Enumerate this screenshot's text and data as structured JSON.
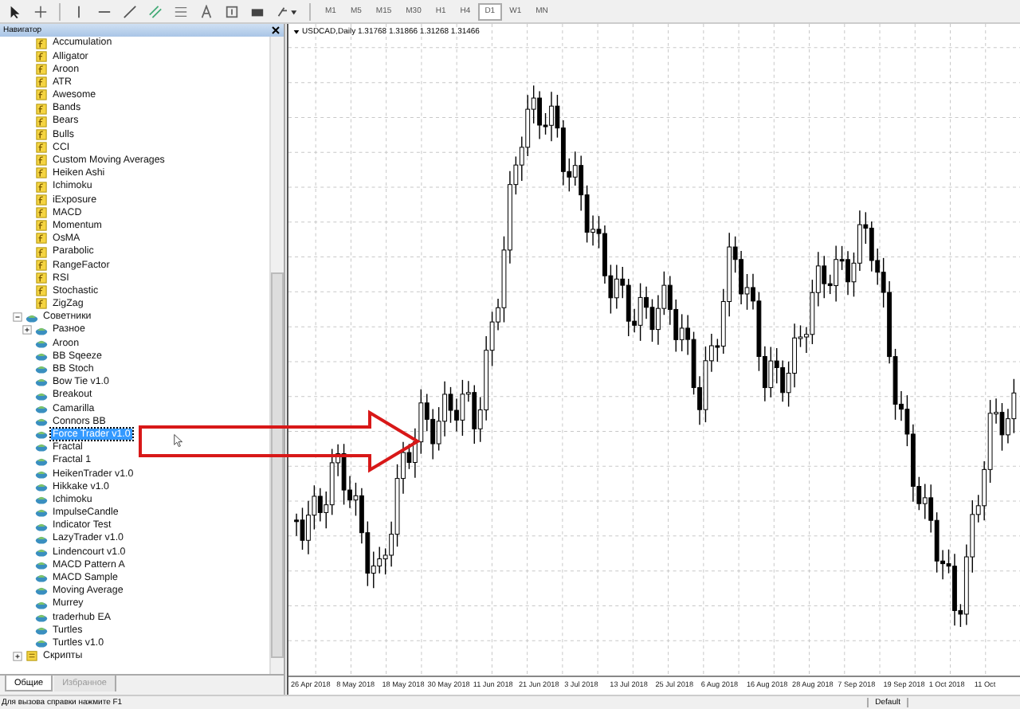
{
  "toolbar": {
    "timeframes": [
      {
        "label": "M1",
        "selected": false
      },
      {
        "label": "M5",
        "selected": false
      },
      {
        "label": "M15",
        "selected": false
      },
      {
        "label": "M30",
        "selected": false
      },
      {
        "label": "H1",
        "selected": false
      },
      {
        "label": "H4",
        "selected": false
      },
      {
        "label": "D1",
        "selected": true
      },
      {
        "label": "W1",
        "selected": false
      },
      {
        "label": "MN",
        "selected": false
      }
    ]
  },
  "navigator": {
    "title": "Навигатор",
    "indicators": [
      {
        "label": "Accumulation",
        "selected": false
      },
      {
        "label": "Alligator",
        "selected": false
      },
      {
        "label": "Aroon",
        "selected": false
      },
      {
        "label": "ATR",
        "selected": false
      },
      {
        "label": "Awesome",
        "selected": false
      },
      {
        "label": "Bands",
        "selected": false
      },
      {
        "label": "Bears",
        "selected": false
      },
      {
        "label": "Bulls",
        "selected": false
      },
      {
        "label": "CCI",
        "selected": false
      },
      {
        "label": "Custom Moving Averages",
        "selected": false
      },
      {
        "label": "Heiken Ashi",
        "selected": false
      },
      {
        "label": "Ichimoku",
        "selected": false
      },
      {
        "label": "iExposure",
        "selected": false
      },
      {
        "label": "MACD",
        "selected": false
      },
      {
        "label": "Momentum",
        "selected": false
      },
      {
        "label": "OsMA",
        "selected": false
      },
      {
        "label": "Parabolic",
        "selected": false
      },
      {
        "label": "RangeFactor",
        "selected": false
      },
      {
        "label": "RSI",
        "selected": false
      },
      {
        "label": "Stochastic",
        "selected": false
      },
      {
        "label": "ZigZag",
        "selected": false
      }
    ],
    "groups": [
      {
        "label": "Советники",
        "kind": "experts",
        "expanded": true,
        "children": [
          {
            "label": "Разное",
            "kind": "folder",
            "expanded": false,
            "selected": false
          },
          {
            "label": "Aroon",
            "kind": "expert",
            "selected": false
          },
          {
            "label": "BB Sqeeze",
            "kind": "expert",
            "selected": false
          },
          {
            "label": "BB Stoch",
            "kind": "expert",
            "selected": false
          },
          {
            "label": "Bow Tie v1.0",
            "kind": "expert",
            "selected": false
          },
          {
            "label": "Breakout",
            "kind": "expert",
            "selected": false
          },
          {
            "label": "Camarilla",
            "kind": "expert",
            "selected": false
          },
          {
            "label": "Connors BB",
            "kind": "expert",
            "selected": false
          },
          {
            "label": "Force Trader v1.0",
            "kind": "expert",
            "selected": true
          },
          {
            "label": "Fractal",
            "kind": "expert",
            "selected": false
          },
          {
            "label": "Fractal 1",
            "kind": "expert",
            "selected": false
          },
          {
            "label": "HeikenTrader v1.0",
            "kind": "expert",
            "selected": false
          },
          {
            "label": "Hikkake v1.0",
            "kind": "expert",
            "selected": false
          },
          {
            "label": "Ichimoku",
            "kind": "expert",
            "selected": false
          },
          {
            "label": "ImpulseCandle",
            "kind": "expert",
            "selected": false
          },
          {
            "label": "Indicator Test",
            "kind": "expert",
            "selected": false
          },
          {
            "label": "LazyTrader v1.0",
            "kind": "expert",
            "selected": false
          },
          {
            "label": "Lindencourt v1.0",
            "kind": "expert",
            "selected": false
          },
          {
            "label": "MACD Pattern A",
            "kind": "expert",
            "selected": false
          },
          {
            "label": "MACD Sample",
            "kind": "expert",
            "selected": false
          },
          {
            "label": "Moving Average",
            "kind": "expert",
            "selected": false
          },
          {
            "label": "Murrey",
            "kind": "expert",
            "selected": false
          },
          {
            "label": "traderhub EA",
            "kind": "expert",
            "selected": false
          },
          {
            "label": "Turtles",
            "kind": "expert",
            "selected": false
          },
          {
            "label": "Turtles v1.0",
            "kind": "expert",
            "selected": false
          }
        ]
      },
      {
        "label": "Скрипты",
        "kind": "scripts",
        "expanded": false
      }
    ],
    "tabs": [
      {
        "label": "Общие",
        "selected": true
      },
      {
        "label": "Избранное",
        "selected": false
      }
    ]
  },
  "chart": {
    "title": "USDCAD,Daily 1.31768 1.31866 1.31268 1.31466",
    "dates": [
      "26 Apr 2018",
      "8 May 2018",
      "18 May 2018",
      "30 May 2018",
      "11 Jun 2018",
      "21 Jun 2018",
      "3 Jul 2018",
      "13 Jul 2018",
      "25 Jul 2018",
      "6 Aug 2018",
      "16 Aug 2018",
      "28 Aug 2018",
      "7 Sep 2018",
      "19 Sep 2018",
      "1 Oct 2018",
      "11 Oct"
    ]
  },
  "status_bar": {
    "help": "Для вызова справки нажмите F1",
    "profile": "Default"
  }
}
